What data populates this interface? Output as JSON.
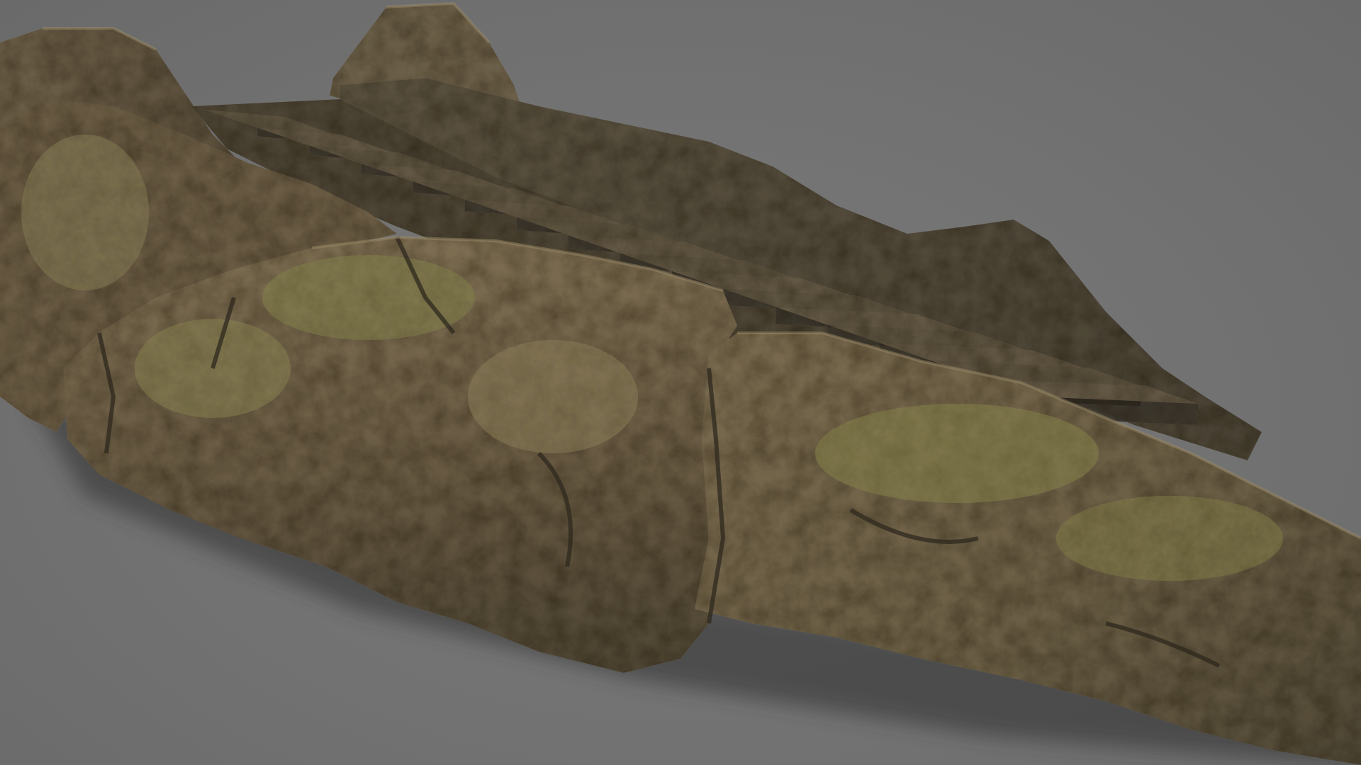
{
  "viewport": {
    "background_color": "#707070"
  },
  "model": {
    "subject": "rock-staircase",
    "colors": {
      "rock_base": "#5e5440",
      "rock_light": "#8a7a5c",
      "rock_dark": "#3a3326",
      "moss": "#6e6a3e",
      "shadow": "#3f3f3f"
    },
    "stair_steps": 16
  }
}
